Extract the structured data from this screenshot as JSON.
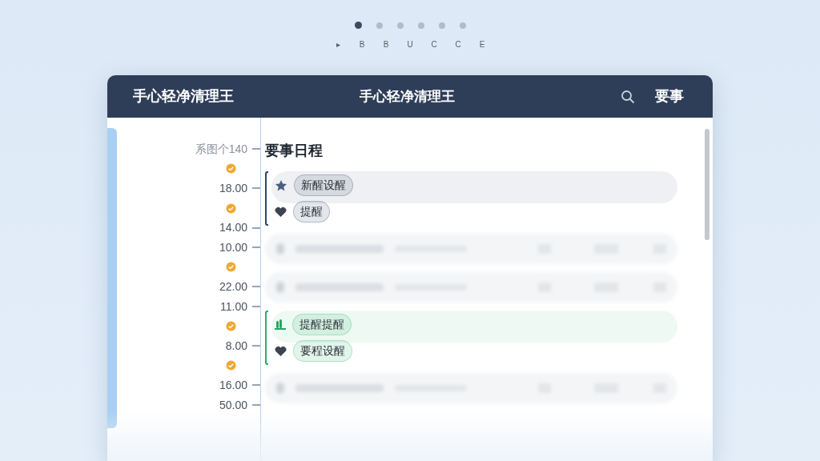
{
  "pager": {
    "dots": [
      {
        "selected": true
      },
      {
        "selected": false
      },
      {
        "selected": false
      },
      {
        "selected": false
      },
      {
        "selected": false
      },
      {
        "selected": false
      }
    ],
    "letters": [
      "▸",
      "B",
      "B",
      "U",
      "C",
      "C",
      "E"
    ]
  },
  "window": {
    "title": "手心轻净清理王",
    "center_title": "手心轻净清理王",
    "action": "要事"
  },
  "timeline": [
    {
      "kind": "label",
      "text": "系图个140"
    },
    {
      "kind": "check"
    },
    {
      "kind": "time",
      "text": "18.00"
    },
    {
      "kind": "check"
    },
    {
      "kind": "time",
      "text": "14.00"
    },
    {
      "kind": "time",
      "text": "10.00"
    },
    {
      "kind": "check"
    },
    {
      "kind": "time",
      "text": "22.00"
    },
    {
      "kind": "time",
      "text": "11.00"
    },
    {
      "kind": "check"
    },
    {
      "kind": "time",
      "text": "8.00"
    },
    {
      "kind": "check"
    },
    {
      "kind": "time",
      "text": "16.00"
    },
    {
      "kind": "time",
      "text": "50.00"
    }
  ],
  "heading": "要事日程",
  "rows": [
    {
      "kind": "group",
      "color": "#2e4566",
      "items": [
        {
          "kind": "star",
          "text": "新醒设醒"
        },
        {
          "kind": "heart",
          "text": "提醒"
        }
      ]
    },
    {
      "kind": "blurred"
    },
    {
      "kind": "blurred"
    },
    {
      "kind": "group",
      "color": "#22b36a",
      "items": [
        {
          "kind": "plant",
          "text": "提醒提醒"
        },
        {
          "kind": "heart",
          "text": "要程设醒"
        }
      ]
    },
    {
      "kind": "blurred"
    }
  ]
}
